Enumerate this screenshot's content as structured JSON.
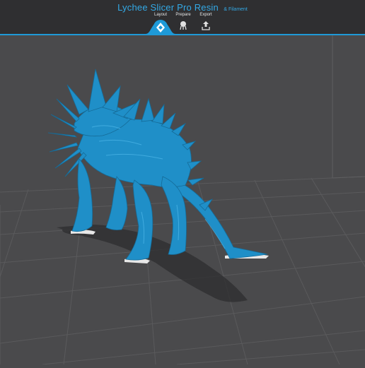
{
  "header": {
    "title": "Lychee Slicer Pro Resin",
    "subtitle": "& Filament"
  },
  "tabs": [
    {
      "label": "Layout",
      "active": true,
      "icon": "layout-cube-icon"
    },
    {
      "label": "Prepare",
      "active": false,
      "icon": "prepare-supports-icon"
    },
    {
      "label": "Export",
      "active": false,
      "icon": "export-upload-icon"
    }
  ],
  "viewport": {
    "model": "dragon-model",
    "model_color": "#1f8fc8",
    "grid_color": "#5e5e60"
  },
  "colors": {
    "accent": "#33a9e6",
    "topbar": "#2f2f31",
    "background": "#4a4a4c"
  }
}
